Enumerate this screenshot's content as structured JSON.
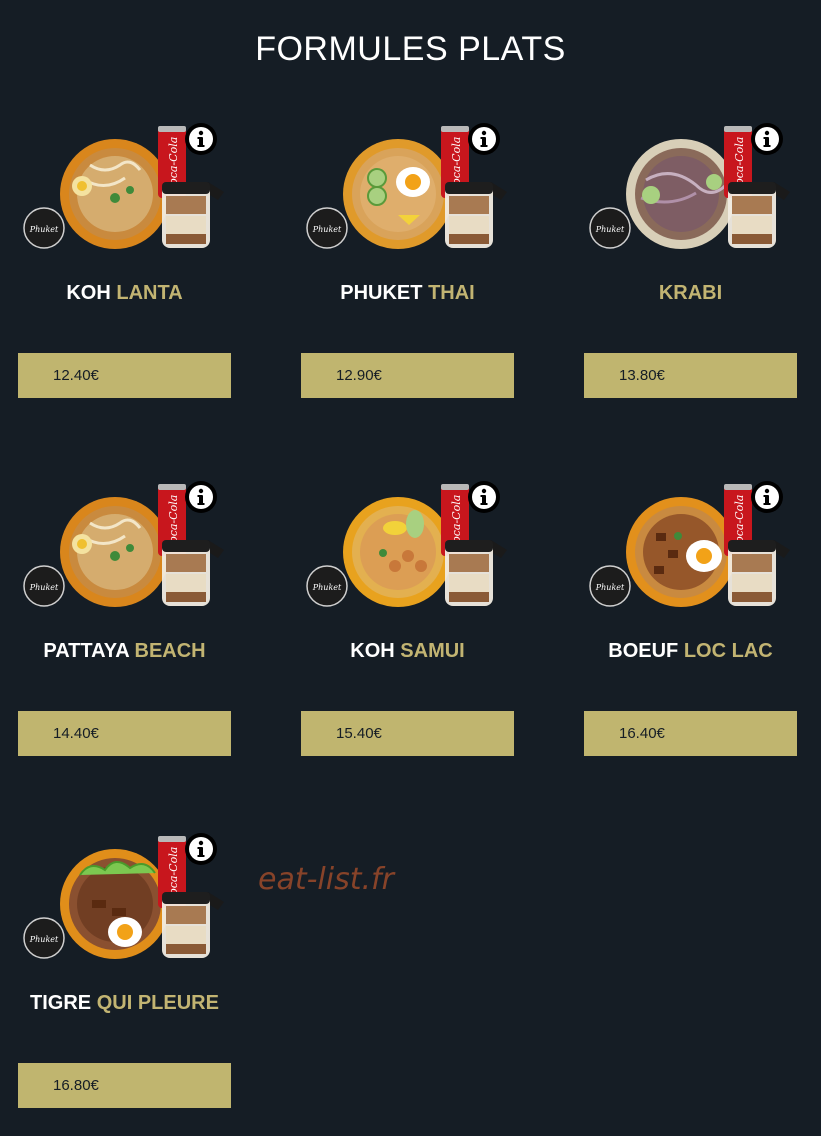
{
  "page": {
    "title": "FORMULES PLATS",
    "watermark": "eat-list.fr"
  },
  "colors": {
    "background": "#151d25",
    "accent": "#c2b472",
    "price_button": "#c0b56f"
  },
  "items": [
    {
      "name_first": "KOH",
      "name_second": "LANTA",
      "price": "12.40€",
      "image": "noodle-bowl-combo",
      "info_icon": "info-icon"
    },
    {
      "name_first": "PHUKET",
      "name_second": "THAI",
      "price": "12.90€",
      "image": "fried-rice-egg-combo",
      "info_icon": "info-icon"
    },
    {
      "name_first": "",
      "name_second": "KRABI",
      "price": "13.80€",
      "image": "glass-noodle-combo",
      "info_icon": "info-icon"
    },
    {
      "name_first": "PATTAYA",
      "name_second": "BEACH",
      "price": "14.40€",
      "image": "noodle-bowl-combo",
      "info_icon": "info-icon"
    },
    {
      "name_first": "KOH",
      "name_second": "SAMUI",
      "price": "15.40€",
      "image": "chicken-rice-combo",
      "info_icon": "info-icon"
    },
    {
      "name_first": "BOEUF",
      "name_second": "LOC LAC",
      "price": "16.40€",
      "image": "beef-rice-egg-combo",
      "info_icon": "info-icon"
    },
    {
      "name_first": "TIGRE",
      "name_second": "QUI PLEURE",
      "price": "16.80€",
      "image": "beef-salad-egg-combo",
      "info_icon": "info-icon"
    }
  ]
}
